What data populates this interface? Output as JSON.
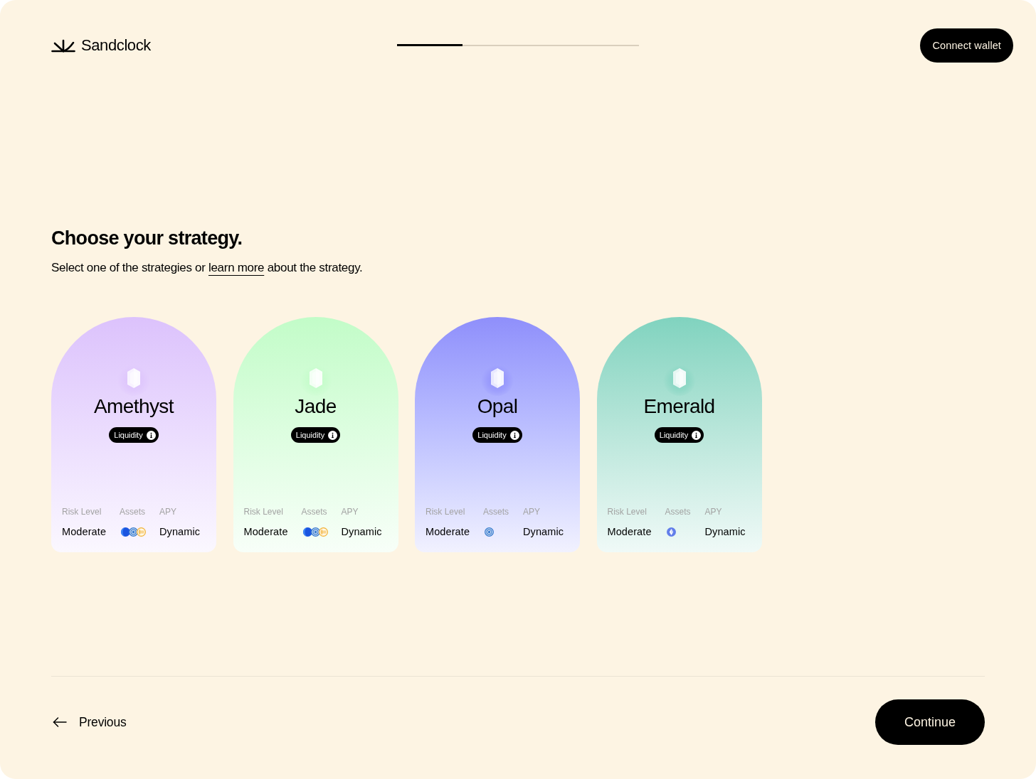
{
  "header": {
    "logo": "Sandclock",
    "progress": {
      "level": 0.27
    },
    "connect_button": "Connect wallet"
  },
  "intro": {
    "title": "Choose your strategy.",
    "subtitle": {
      "before": "Select one of the strategies or ",
      "link": "learn more",
      "after": " about the strategy."
    }
  },
  "cards": [
    {
      "name": "Amethyst",
      "color": "#dcc2fc",
      "selected": false,
      "tag": "Liquidity",
      "risk_level": {
        "label": "Risk Level",
        "value": "Moderate"
      },
      "assets": {
        "label": "Assets",
        "coins": [
          {
            "kind": "half-disc"
          },
          {
            "kind": "ring"
          },
          {
            "kind": "striped"
          }
        ]
      },
      "apy": {
        "label": "APY",
        "value": "Dynamic"
      }
    },
    {
      "name": "Jade",
      "color": "#c2fcc8",
      "selected": false,
      "tag": "Liquidity",
      "risk_level": {
        "label": "Risk Level",
        "value": "Moderate"
      },
      "assets": {
        "label": "Assets",
        "coins": [
          {
            "kind": "half-disc"
          },
          {
            "kind": "ring"
          },
          {
            "kind": "striped"
          }
        ]
      },
      "apy": {
        "label": "APY",
        "value": "Dynamic"
      }
    },
    {
      "name": "Opal",
      "color": "#8f8ffb",
      "selected": false,
      "tag": "Liquidity",
      "risk_level": {
        "label": "Risk Level",
        "value": "Moderate"
      },
      "assets": {
        "label": "Assets",
        "coins": [
          {
            "kind": "ring"
          }
        ]
      },
      "apy": {
        "label": "APY",
        "value": "Dynamic"
      }
    },
    {
      "name": "Emerald",
      "color": "#80d3bf",
      "selected": false,
      "tag": "Liquidity",
      "risk_level": {
        "label": "Risk Level",
        "value": "Moderate"
      },
      "assets": {
        "label": "Assets",
        "coins": [
          {
            "kind": "diamond"
          }
        ]
      },
      "apy": {
        "label": "APY",
        "value": "Dynamic"
      }
    }
  ],
  "footer": {
    "previous": "Previous",
    "continue": "Continue"
  }
}
